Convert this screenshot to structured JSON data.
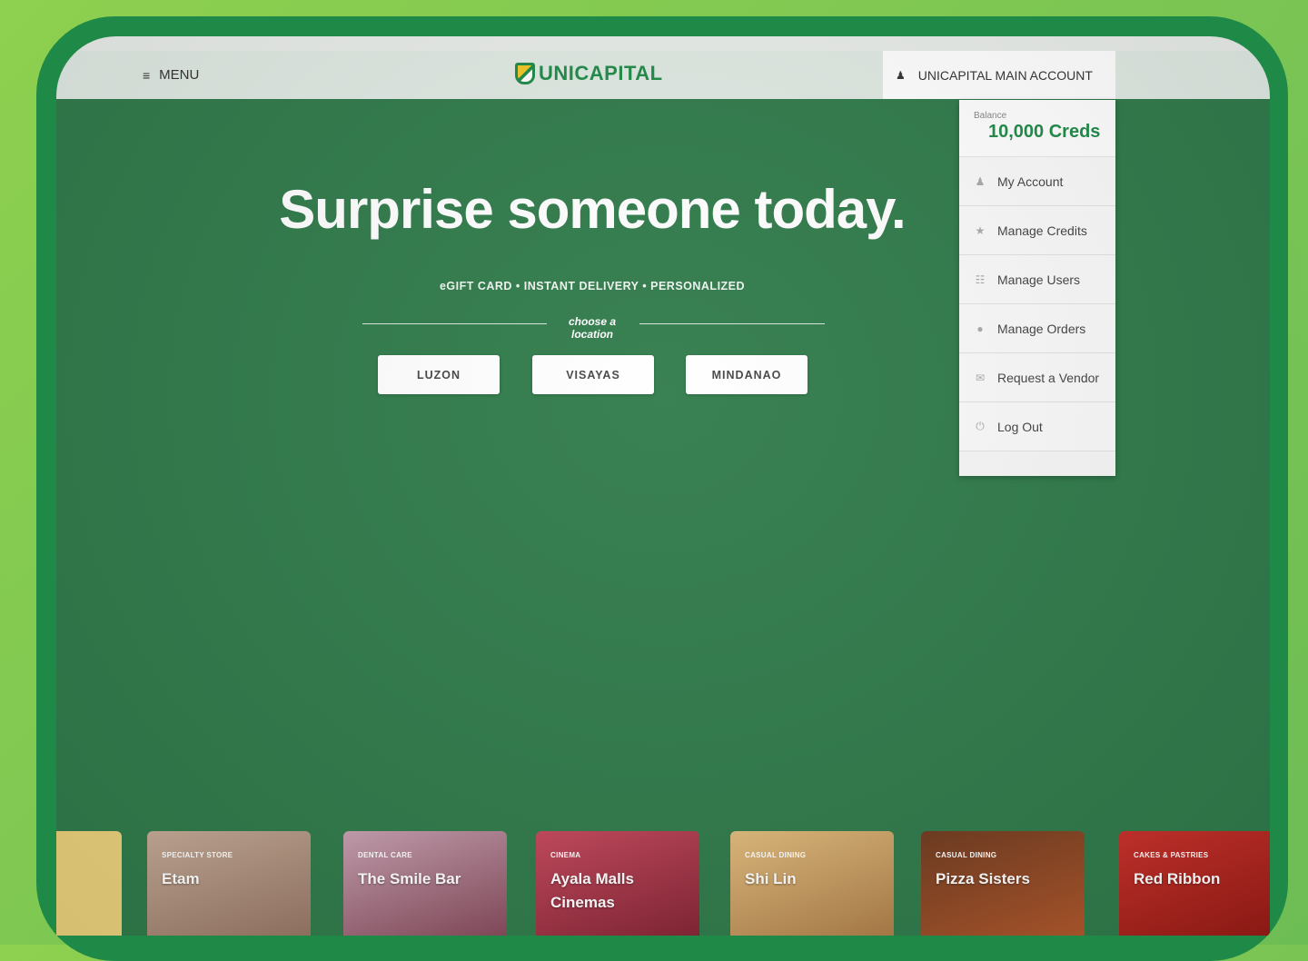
{
  "navbar": {
    "menu_label": "MENU",
    "menu_icon": "hamburger-icon",
    "logo_text": "UNICAPITAL",
    "account_label": "UNICAPITAL MAIN ACCOUNT",
    "account_icon": "user-icon"
  },
  "dropdown": {
    "balance_label": "Balance",
    "balance_value": "10,000 Creds",
    "items": [
      {
        "label": "My Account",
        "icon": "user-icon",
        "glyph": "♟"
      },
      {
        "label": "Manage Credits",
        "icon": "star-icon",
        "glyph": "★"
      },
      {
        "label": "Manage Users",
        "icon": "users-icon",
        "glyph": "☷"
      },
      {
        "label": "Manage Orders",
        "icon": "orders-icon",
        "glyph": "●"
      },
      {
        "label": "Request a Vendor",
        "icon": "mail-icon",
        "glyph": "✉"
      },
      {
        "label": "Log Out",
        "icon": "power-icon",
        "glyph": "⏻"
      }
    ]
  },
  "hero": {
    "title": "Surprise someone today.",
    "subtitle": "eGIFT CARD • INSTANT DELIVERY • PERSONALIZED",
    "choose_label": "choose a location",
    "locations": [
      "LUZON",
      "VISAYAS",
      "MINDANAO"
    ]
  },
  "vendors": [
    {
      "category": "",
      "name": "",
      "color": "#e9cf7b"
    },
    {
      "category": "SPECIALTY STORE",
      "name": "Etam",
      "color": "#b89a86"
    },
    {
      "category": "DENTAL CARE",
      "name": "The Smile Bar",
      "color": "#b07a8a"
    },
    {
      "category": "CINEMA",
      "name": "Ayala Malls Cinemas",
      "color": "#a33a4c"
    },
    {
      "category": "CASUAL DINING",
      "name": "Shi Lin",
      "color": "#c89a5e"
    },
    {
      "category": "CASUAL DINING",
      "name": "Pizza Sisters",
      "color": "#8a4a2a"
    },
    {
      "category": "CAKES & PASTRIES",
      "name": "Red Ribbon",
      "color": "#b3281f"
    }
  ],
  "colors": {
    "brand_green": "#1f8a47",
    "hero_bg": "#2f7a4a",
    "outer_bg": "#7cc653"
  }
}
